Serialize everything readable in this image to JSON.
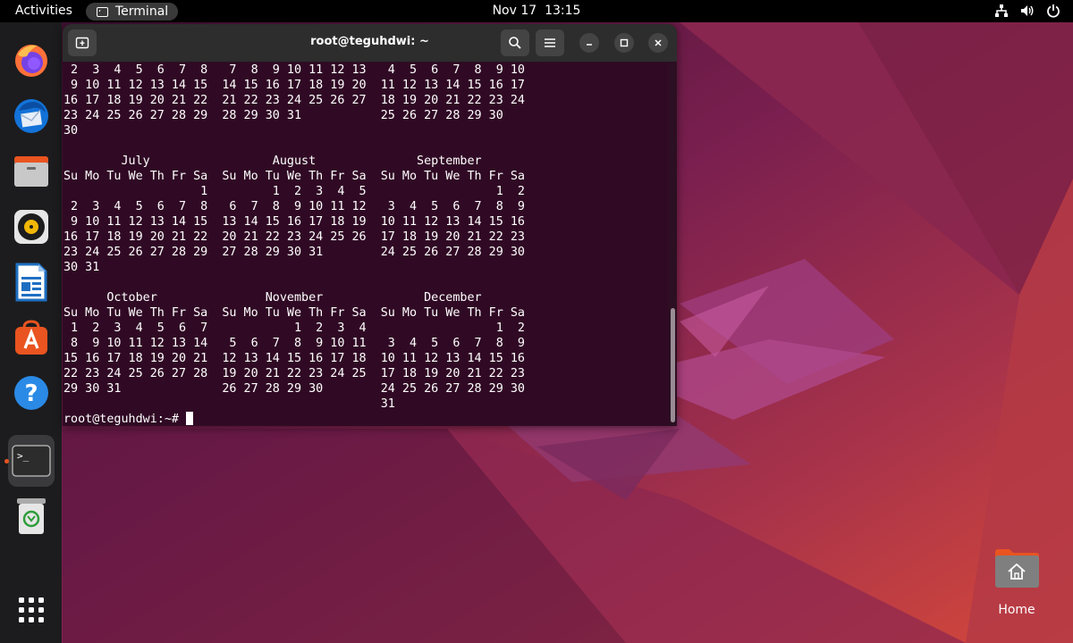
{
  "topbar": {
    "activities": "Activities",
    "app_name": "Terminal",
    "date": "Nov 17",
    "time": "13:15",
    "tray_icons": [
      "network-icon",
      "volume-icon",
      "power-icon"
    ]
  },
  "dock": {
    "items": [
      {
        "name": "firefox",
        "icon": "firefox-icon"
      },
      {
        "name": "thunderbird",
        "icon": "thunderbird-icon"
      },
      {
        "name": "files",
        "icon": "files-icon"
      },
      {
        "name": "rhythmbox",
        "icon": "rhythmbox-icon"
      },
      {
        "name": "libreoffice-writer",
        "icon": "writer-icon"
      },
      {
        "name": "app-center",
        "icon": "app-center-icon"
      },
      {
        "name": "help",
        "icon": "help-icon"
      },
      {
        "name": "terminal",
        "icon": "terminal-icon",
        "active": true
      },
      {
        "name": "trash",
        "icon": "trash-icon"
      },
      {
        "name": "show-apps",
        "icon": "app-grid-icon"
      }
    ]
  },
  "terminal": {
    "title": "root@teguhdwi: ~",
    "output": " 2  3  4  5  6  7  8   7  8  9 10 11 12 13   4  5  6  7  8  9 10\n 9 10 11 12 13 14 15  14 15 16 17 18 19 20  11 12 13 14 15 16 17\n16 17 18 19 20 21 22  21 22 23 24 25 26 27  18 19 20 21 22 23 24\n23 24 25 26 27 28 29  28 29 30 31           25 26 27 28 29 30\n30\n\n        July                 August              September\nSu Mo Tu We Th Fr Sa  Su Mo Tu We Th Fr Sa  Su Mo Tu We Th Fr Sa\n                   1         1  2  3  4  5                  1  2\n 2  3  4  5  6  7  8   6  7  8  9 10 11 12   3  4  5  6  7  8  9\n 9 10 11 12 13 14 15  13 14 15 16 17 18 19  10 11 12 13 14 15 16\n16 17 18 19 20 21 22  20 21 22 23 24 25 26  17 18 19 20 21 22 23\n23 24 25 26 27 28 29  27 28 29 30 31        24 25 26 27 28 29 30\n30 31\n\n      October               November              December\nSu Mo Tu We Th Fr Sa  Su Mo Tu We Th Fr Sa  Su Mo Tu We Th Fr Sa\n 1  2  3  4  5  6  7            1  2  3  4                  1  2\n 8  9 10 11 12 13 14   5  6  7  8  9 10 11   3  4  5  6  7  8  9\n15 16 17 18 19 20 21  12 13 14 15 16 17 18  10 11 12 13 14 15 16\n22 23 24 25 26 27 28  19 20 21 22 23 24 25  17 18 19 20 21 22 23\n29 30 31              26 27 28 29 30        24 25 26 27 28 29 30\n                                            31",
    "prompt": "root@teguhdwi:~# ",
    "colors": {
      "background": "#300a24",
      "header": "#2d2d2d",
      "text": "#ffffff"
    }
  },
  "desktop": {
    "home_label": "Home"
  },
  "colors": {
    "accent": "#e95420",
    "topbar": "#000000",
    "dock": "#1c1c1e"
  }
}
